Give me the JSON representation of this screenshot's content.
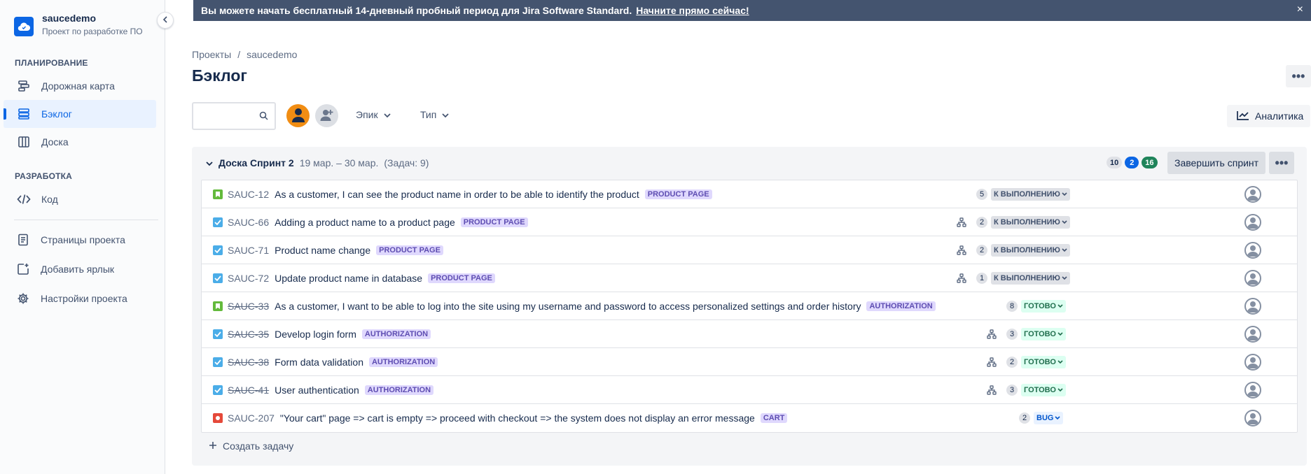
{
  "sidebar": {
    "project_name": "saucedemo",
    "project_type": "Проект по разработке ПО",
    "section_planning": "ПЛАНИРОВАНИЕ",
    "section_dev": "РАЗРАБОТКА",
    "items": [
      {
        "label": "Дорожная карта",
        "icon": "roadmap-icon"
      },
      {
        "label": "Бэклог",
        "icon": "backlog-icon",
        "active": true
      },
      {
        "label": "Доска",
        "icon": "board-icon"
      },
      {
        "label": "Код",
        "icon": "code-icon"
      },
      {
        "label": "Страницы проекта",
        "icon": "pages-icon"
      },
      {
        "label": "Добавить ярлык",
        "icon": "add-shortcut-icon"
      },
      {
        "label": "Настройки проекта",
        "icon": "settings-icon"
      }
    ]
  },
  "banner": {
    "text": "Вы можете начать бесплатный 14-дневный пробный период для Jira Software Standard.",
    "link": "Начните прямо сейчас!",
    "close": "×"
  },
  "header": {
    "breadcrumb_projects": "Проекты",
    "breadcrumb_sep": "/",
    "breadcrumb_project": "saucedemo",
    "title": "Бэклог"
  },
  "toolbar": {
    "search_placeholder": "",
    "filter_epic": "Эпик",
    "filter_type": "Тип",
    "analytics": "Аналитика"
  },
  "sprint": {
    "name": "Доска Спринт 2",
    "dates": "19 мар. – 30 мар.",
    "count": "(Задач: 9)",
    "todo_points": "10",
    "progress_points": "2",
    "done_points": "16",
    "complete_label": "Завершить спринт",
    "more": "•••"
  },
  "issues": [
    {
      "key": "SAUC-12",
      "type": "story",
      "done": false,
      "summary": "As a customer, I can see the product name in order to be able to identify the product",
      "epic": "PRODUCT PAGE",
      "children": false,
      "points": "5",
      "status": "К ВЫПОЛНЕНИЮ",
      "status_kind": "todo"
    },
    {
      "key": "SAUC-66",
      "type": "task",
      "done": false,
      "summary": "Adding a product name to a product page",
      "epic": "PRODUCT PAGE",
      "children": true,
      "points": "2",
      "status": "К ВЫПОЛНЕНИЮ",
      "status_kind": "todo"
    },
    {
      "key": "SAUC-71",
      "type": "task",
      "done": false,
      "summary": "Product name change",
      "epic": "PRODUCT PAGE",
      "children": true,
      "points": "2",
      "status": "К ВЫПОЛНЕНИЮ",
      "status_kind": "todo"
    },
    {
      "key": "SAUC-72",
      "type": "task",
      "done": false,
      "summary": "Update product name in database",
      "epic": "PRODUCT PAGE",
      "children": true,
      "points": "1",
      "status": "К ВЫПОЛНЕНИЮ",
      "status_kind": "todo"
    },
    {
      "key": "SAUC-33",
      "type": "story",
      "done": true,
      "summary": "As a customer, I want to be able to log into the site using my username and password to access personalized settings and order history",
      "epic": "AUTHORIZATION",
      "children": false,
      "points": "8",
      "status": "ГОТОВО",
      "status_kind": "done"
    },
    {
      "key": "SAUC-35",
      "type": "task",
      "done": true,
      "summary": "Develop login form",
      "epic": "AUTHORIZATION",
      "children": true,
      "points": "3",
      "status": "ГОТОВО",
      "status_kind": "done"
    },
    {
      "key": "SAUC-38",
      "type": "task",
      "done": true,
      "summary": "Form data validation",
      "epic": "AUTHORIZATION",
      "children": true,
      "points": "2",
      "status": "ГОТОВО",
      "status_kind": "done"
    },
    {
      "key": "SAUC-41",
      "type": "task",
      "done": true,
      "summary": "User authentication",
      "epic": "AUTHORIZATION",
      "children": true,
      "points": "3",
      "status": "ГОТОВО",
      "status_kind": "done"
    },
    {
      "key": "SAUC-207",
      "type": "bug",
      "done": false,
      "summary": "\"Your cart\" page => cart is empty => proceed with checkout => the system does not display an error message",
      "epic": "CART",
      "children": false,
      "points": "2",
      "status": "BUG",
      "status_kind": "bug"
    }
  ],
  "create_issue": "Создать задачу",
  "colors": {
    "accent": "#0c66e4",
    "banner": "#44546f",
    "epic_bg": "#dfd8fd",
    "epic_text": "#5e4db2",
    "done_badge": "#1f845a"
  }
}
